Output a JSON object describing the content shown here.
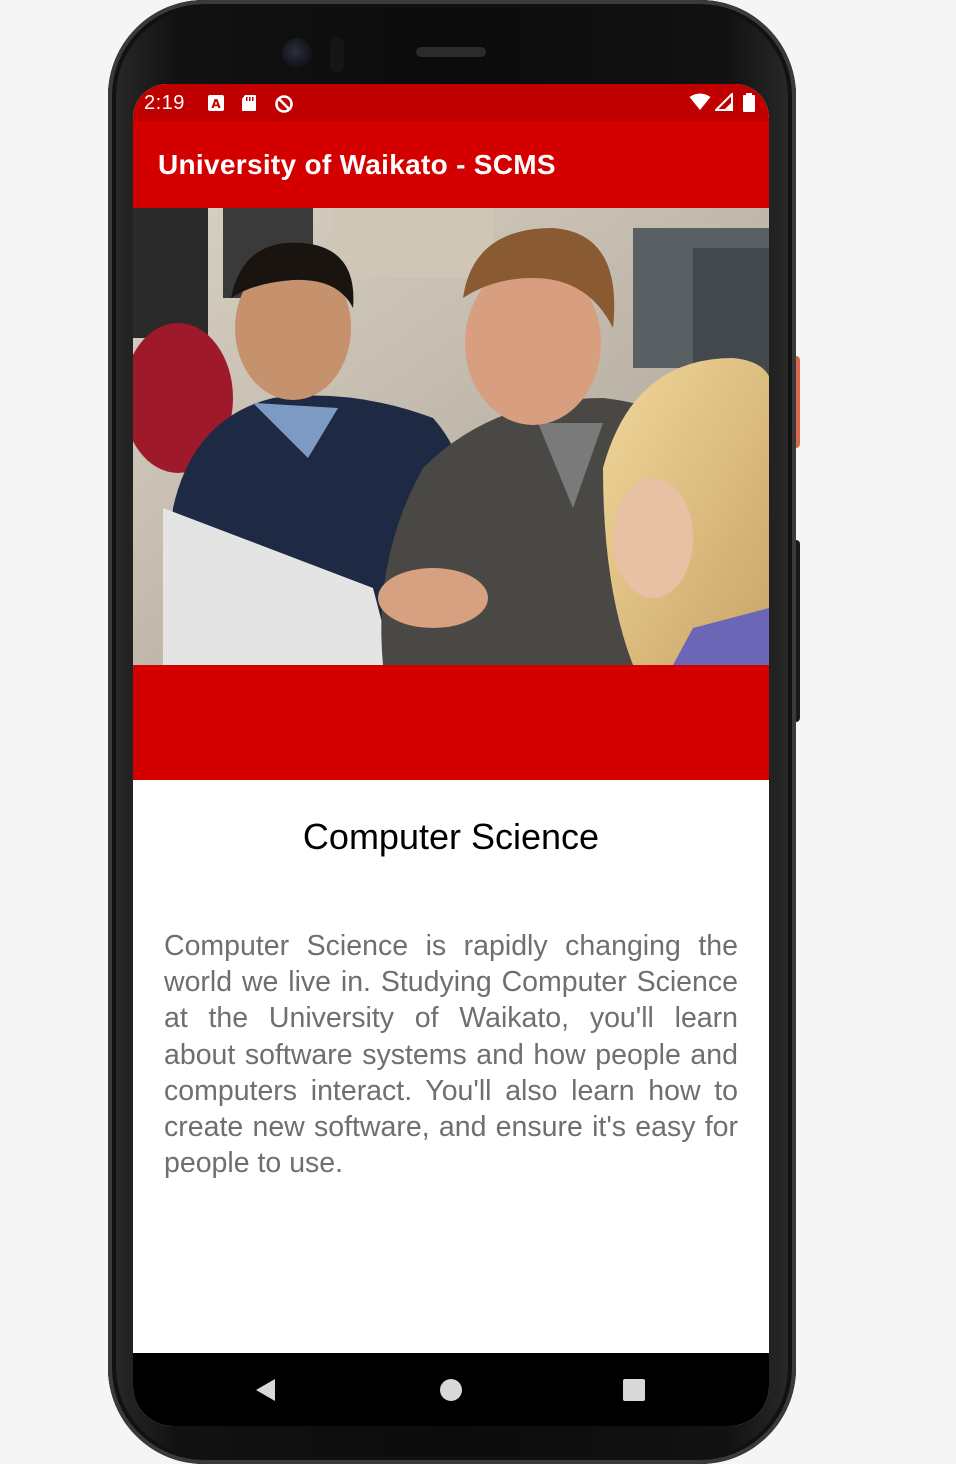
{
  "status_bar": {
    "time": "2:19",
    "icons": [
      "a11y-icon",
      "sd-card-icon",
      "data-saver-icon",
      "wifi-icon",
      "cell-signal-icon",
      "battery-icon"
    ],
    "color": "#c00000"
  },
  "app_bar": {
    "title": "University of Waikato - SCMS",
    "color": "#d40000"
  },
  "hero": {
    "image": "photo of students at a computer"
  },
  "course": {
    "title": "Computer Science",
    "description": "Computer Science is rapidly changing the world we live in. Studying Computer Science at the University of Waikato, you'll learn about software systems and how people and computers interact. You'll also learn how to create new software, and ensure it's easy for people to use."
  },
  "nav_bar": {
    "buttons": [
      "back-icon",
      "home-icon",
      "recents-icon"
    ]
  },
  "colors": {
    "accent": "#d40000",
    "description_text": "#6f6f6f"
  }
}
